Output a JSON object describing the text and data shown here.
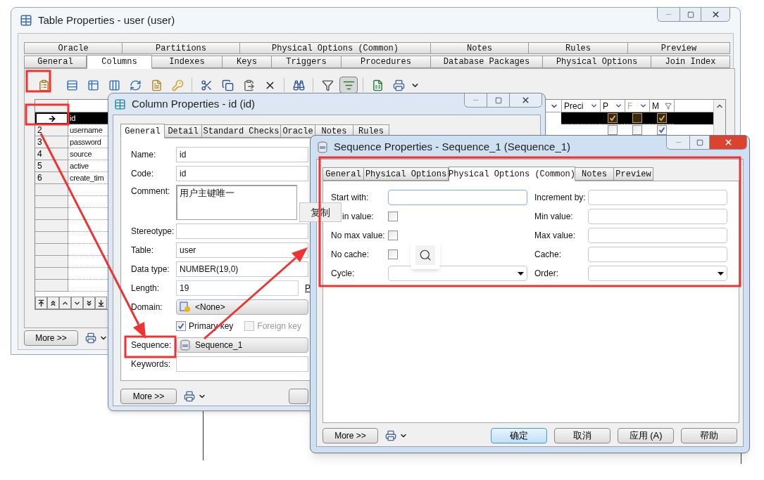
{
  "table_window": {
    "title": "Table Properties - user (user)",
    "tab_rows": [
      [
        {
          "label": "Oracle",
          "selected": false
        },
        {
          "label": "Partitions",
          "selected": false
        },
        {
          "label": "Physical Options (Common)",
          "selected": false
        },
        {
          "label": "Notes",
          "selected": false
        },
        {
          "label": "Rules",
          "selected": false
        },
        {
          "label": "Preview",
          "selected": false
        }
      ],
      [
        {
          "label": "General",
          "selected": false
        },
        {
          "label": "Columns",
          "selected": true
        },
        {
          "label": "Indexes",
          "selected": false
        },
        {
          "label": "Keys",
          "selected": false
        },
        {
          "label": "Triggers",
          "selected": false
        },
        {
          "label": "Procedures",
          "selected": false
        },
        {
          "label": "Database Packages",
          "selected": false
        },
        {
          "label": "Physical Options",
          "selected": false
        },
        {
          "label": "Join Index",
          "selected": false
        }
      ]
    ],
    "toolbar": [
      {
        "kind": "properties",
        "pressed": false
      },
      {
        "kind": "insert_row",
        "pressed": false
      },
      {
        "kind": "add_row",
        "pressed": false
      },
      {
        "kind": "add_columns",
        "pressed": false
      },
      {
        "kind": "reuse",
        "pressed": false
      },
      {
        "kind": "new",
        "pressed": false
      },
      {
        "kind": "key",
        "pressed": false
      },
      {
        "kind": "cut",
        "pressed": false
      },
      {
        "kind": "copy",
        "pressed": false
      },
      {
        "kind": "paste",
        "pressed": false
      },
      {
        "kind": "delete",
        "pressed": false
      },
      {
        "kind": "find",
        "pressed": false
      },
      {
        "kind": "filter",
        "pressed": false
      },
      {
        "kind": "filter_list",
        "pressed": true
      },
      {
        "kind": "excel",
        "pressed": false
      },
      {
        "kind": "print",
        "pressed": false
      }
    ],
    "grid": {
      "headers": [
        {
          "label": "Preci",
          "dimmed": false,
          "filtered": false
        },
        {
          "label": "P",
          "dimmed": false,
          "filtered": false
        },
        {
          "label": "F",
          "dimmed": true,
          "filtered": false
        },
        {
          "label": "M",
          "dimmed": false,
          "filtered": true
        }
      ],
      "rows": [
        {
          "selected": true,
          "name": "id",
          "p": true,
          "f": false,
          "m": true
        },
        {
          "selected": false,
          "number": "2",
          "name": "username",
          "p": false,
          "f": false,
          "m": true
        },
        {
          "selected": false,
          "number": "3",
          "name": "password"
        },
        {
          "selected": false,
          "number": "4",
          "name": "source"
        },
        {
          "selected": false,
          "number": "5",
          "name": "active"
        },
        {
          "selected": false,
          "number": "6",
          "name": "create_tim"
        }
      ]
    },
    "more_button": "More >>"
  },
  "column_window": {
    "title": "Column Properties - id (id)",
    "tabs": [
      {
        "label": "General",
        "selected": true
      },
      {
        "label": "Detail",
        "selected": false
      },
      {
        "label": "Standard Checks",
        "selected": false
      },
      {
        "label": "Oracle",
        "selected": false
      },
      {
        "label": "Notes",
        "selected": false
      },
      {
        "label": "Rules",
        "selected": false
      }
    ],
    "fields": [
      {
        "kind": "text",
        "label": "Name:",
        "value": "id"
      },
      {
        "kind": "text",
        "label": "Code:",
        "value": "id"
      },
      {
        "kind": "textarea",
        "label": "Comment:",
        "value": "用户主键唯一"
      },
      {
        "kind": "text",
        "label": "Stereotype:"
      },
      {
        "kind": "text",
        "label": "Table:",
        "value": "user"
      },
      {
        "kind": "text",
        "label": "Data type:",
        "value": "NUMBER(19,0)"
      },
      {
        "kind": "short",
        "label": "Length:",
        "value": "19",
        "side_label": "P"
      },
      {
        "kind": "domain",
        "label": "Domain:",
        "value": "<None>"
      },
      {
        "kind": "checks",
        "checks": [
          {
            "label": "Primary key",
            "checked": true,
            "disabled": false
          },
          {
            "label": "Foreign key",
            "checked": false,
            "disabled": true
          }
        ]
      },
      {
        "kind": "sequence",
        "label": "Sequence:",
        "value": "Sequence_1"
      },
      {
        "kind": "text",
        "label": "Keywords:"
      }
    ],
    "more_button": "More >>"
  },
  "sequence_window": {
    "title": "Sequence Properties - Sequence_1 (Sequence_1)",
    "tabs": [
      {
        "label": "General",
        "selected": false
      },
      {
        "label": "Physical Options",
        "selected": false
      },
      {
        "label": "Physical Options (Common)",
        "selected": true
      },
      {
        "label": "Notes",
        "selected": false
      },
      {
        "label": "Preview",
        "selected": false
      }
    ],
    "left_fields": [
      {
        "kind": "text",
        "label": "Start with:",
        "focused": true
      },
      {
        "kind": "check",
        "label": "in value:",
        "checked": false,
        "covered": true
      },
      {
        "kind": "check",
        "label": "No max value:",
        "checked": false,
        "covered": false
      },
      {
        "kind": "check",
        "label": "No cache:",
        "checked": false,
        "covered": false
      },
      {
        "kind": "dropdown",
        "label": "Cycle:"
      }
    ],
    "right_fields": [
      {
        "kind": "text",
        "label": "Increment by:",
        "focused": false
      },
      {
        "kind": "text",
        "label": "Min value:",
        "focused": false
      },
      {
        "kind": "text",
        "label": "Max value:",
        "focused": false
      },
      {
        "kind": "text",
        "label": "Cache:",
        "focused": false
      },
      {
        "kind": "dropdown",
        "label": "Order:"
      }
    ],
    "more_button": "More >>",
    "buttons": [
      {
        "label": "确定",
        "default": true
      },
      {
        "label": "取消",
        "default": false
      },
      {
        "label": "应用 (A)",
        "default": false
      },
      {
        "label": "帮助",
        "default": false
      }
    ]
  },
  "context_menu": {
    "label": "复制"
  }
}
